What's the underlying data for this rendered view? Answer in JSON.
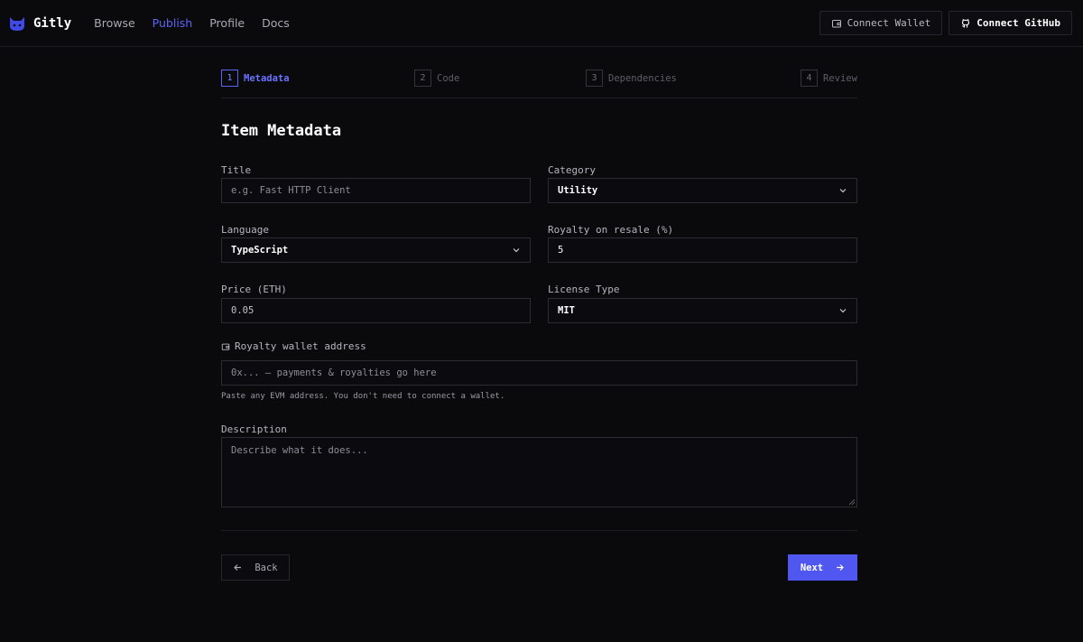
{
  "app": {
    "name": "Gitly",
    "accent": "#5b64f5"
  },
  "nav": {
    "items": [
      {
        "label": "Browse"
      },
      {
        "label": "Publish",
        "active": true
      },
      {
        "label": "Profile"
      },
      {
        "label": "Docs"
      }
    ]
  },
  "header_actions": {
    "connect_wallet": "Connect Wallet",
    "connect_github": "Connect GitHub"
  },
  "steps": [
    {
      "num": "1",
      "label": "Metadata",
      "active": true
    },
    {
      "num": "2",
      "label": "Code"
    },
    {
      "num": "3",
      "label": "Dependencies"
    },
    {
      "num": "4",
      "label": "Review"
    }
  ],
  "form": {
    "title": "Item Metadata",
    "title_field": {
      "label": "Title",
      "placeholder": "e.g. Fast HTTP Client"
    },
    "category": {
      "label": "Category",
      "value": "Utility"
    },
    "language": {
      "label": "Language",
      "value": "TypeScript"
    },
    "royalty": {
      "label": "Royalty on resale (%)",
      "value": "5"
    },
    "price": {
      "label": "Price (ETH)",
      "value": "0.05"
    },
    "license": {
      "label": "License Type",
      "value": "MIT"
    },
    "wallet": {
      "label": "Royalty wallet address",
      "placeholder": "0x... — payments & royalties go here",
      "hint": "Paste any EVM address. You don't need to connect a wallet."
    },
    "description": {
      "label": "Description",
      "placeholder": "Describe what it does..."
    }
  },
  "footer": {
    "back": "Back",
    "next": "Next"
  }
}
